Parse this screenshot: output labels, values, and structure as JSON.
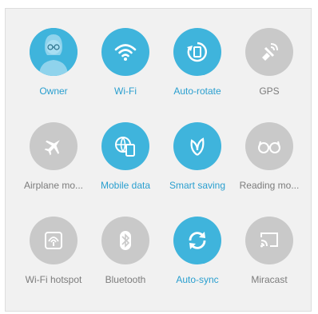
{
  "colors": {
    "active": "#3fb4dc",
    "inactive": "#c9c9c9",
    "active_label": "#2a9fcf",
    "inactive_label": "#7c7c7c",
    "panel_bg": "#f1f1f1"
  },
  "tiles": [
    {
      "label": "Owner",
      "icon": "user-avatar-icon",
      "state": "on"
    },
    {
      "label": "Wi-Fi",
      "icon": "wifi-icon",
      "state": "on"
    },
    {
      "label": "Auto-rotate",
      "icon": "auto-rotate-icon",
      "state": "on"
    },
    {
      "label": "GPS",
      "icon": "gps-icon",
      "state": "off"
    },
    {
      "label": "Airplane mo...",
      "icon": "airplane-icon",
      "state": "off"
    },
    {
      "label": "Mobile data",
      "icon": "mobile-data-icon",
      "state": "on"
    },
    {
      "label": "Smart saving",
      "icon": "leaf-icon",
      "state": "on"
    },
    {
      "label": "Reading mo...",
      "icon": "glasses-icon",
      "state": "off"
    },
    {
      "label": "Wi-Fi hotspot",
      "icon": "hotspot-icon",
      "state": "off"
    },
    {
      "label": "Bluetooth",
      "icon": "bluetooth-icon",
      "state": "off"
    },
    {
      "label": "Auto-sync",
      "icon": "sync-icon",
      "state": "on"
    },
    {
      "label": "Miracast",
      "icon": "cast-icon",
      "state": "off"
    }
  ]
}
